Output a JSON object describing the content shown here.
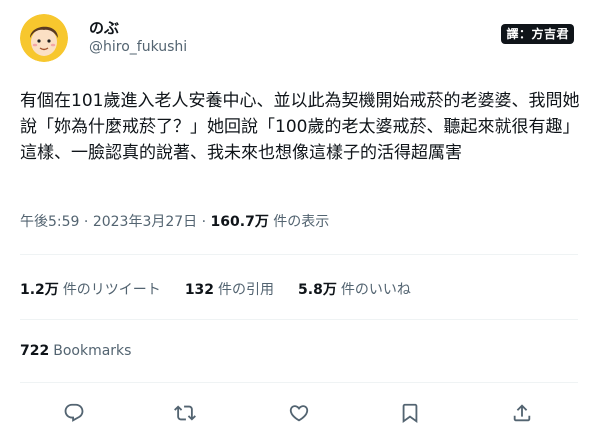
{
  "user": {
    "display_name": "のぶ",
    "handle": "@hiro_fukushi"
  },
  "translator_badge": "譯：方吉君",
  "tweet": {
    "text": "有個在101歲進入老人安養中心、並以此為契機開始戒菸的老婆婆、我問她說「妳為什麼戒菸了？」她回說「100歲的老太婆戒菸、聽起來就很有趣」這樣、一臉認真的說著、我未來也想像這樣子的活得超厲害"
  },
  "meta": {
    "time": "午後5:59",
    "separator": "·",
    "date": "2023年3月27日",
    "views_count": "160.7万",
    "views_label": "件の表示"
  },
  "stats": {
    "retweets_count": "1.2万",
    "retweets_label": "件のリツイート",
    "quotes_count": "132",
    "quotes_label": "件の引用",
    "likes_count": "5.8万",
    "likes_label": "件のいいね"
  },
  "bookmarks": {
    "count": "722",
    "label": "Bookmarks"
  },
  "icons": {
    "reply": "reply-icon",
    "retweet": "retweet-icon",
    "like": "heart-icon",
    "bookmark": "bookmark-icon",
    "share": "share-icon"
  },
  "colors": {
    "text": "#0f1419",
    "secondary": "#536471",
    "avatar_bg": "#f7c72e"
  }
}
